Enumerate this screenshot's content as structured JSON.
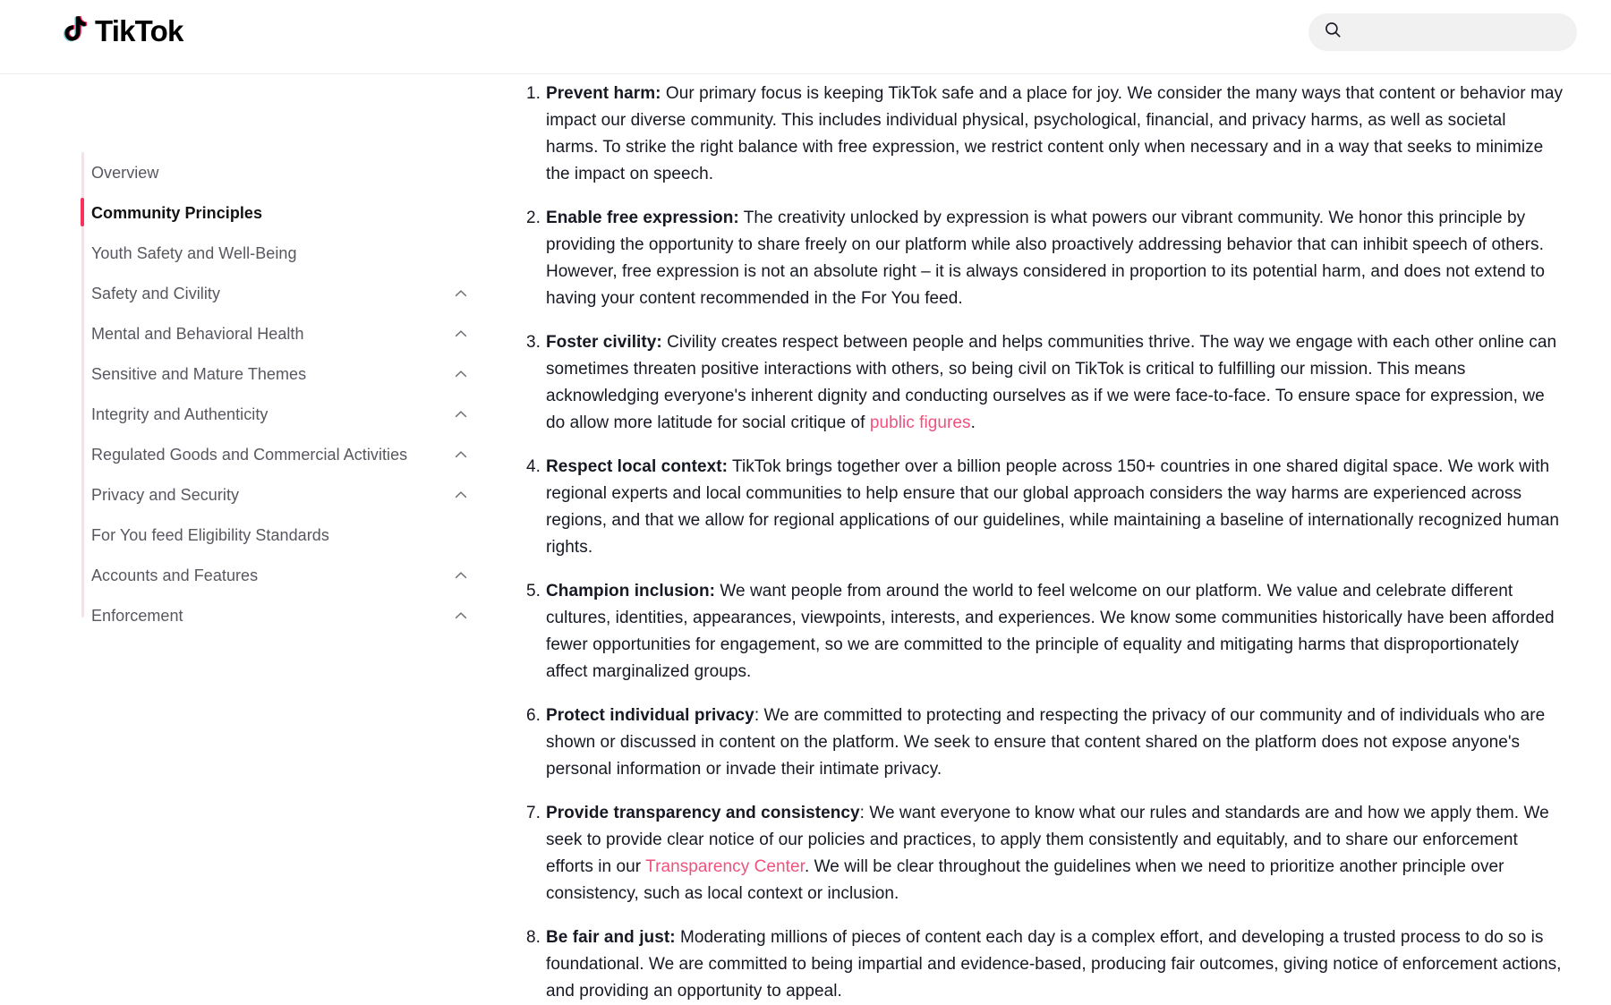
{
  "header": {
    "logo_word": "TikTok",
    "logo_icon": "tiktok-note-icon",
    "search": {
      "icon": "search-icon",
      "value": "",
      "placeholder": ""
    }
  },
  "sidebar": {
    "items": [
      {
        "label": "Overview",
        "active": false,
        "expandable": false,
        "chevron": ""
      },
      {
        "label": "Community Principles",
        "active": true,
        "expandable": false,
        "chevron": ""
      },
      {
        "label": "Youth Safety and Well-Being",
        "active": false,
        "expandable": false,
        "chevron": ""
      },
      {
        "label": "Safety and Civility",
        "active": false,
        "expandable": true,
        "chevron": "chevron-up-icon"
      },
      {
        "label": "Mental and Behavioral Health",
        "active": false,
        "expandable": true,
        "chevron": "chevron-up-icon"
      },
      {
        "label": "Sensitive and Mature Themes",
        "active": false,
        "expandable": true,
        "chevron": "chevron-up-icon"
      },
      {
        "label": "Integrity and Authenticity",
        "active": false,
        "expandable": true,
        "chevron": "chevron-up-icon"
      },
      {
        "label": "Regulated Goods and Commercial Activities",
        "active": false,
        "expandable": true,
        "chevron": "chevron-up-icon"
      },
      {
        "label": "Privacy and Security",
        "active": false,
        "expandable": true,
        "chevron": "chevron-up-icon"
      },
      {
        "label": "For You feed Eligibility Standards",
        "active": false,
        "expandable": false,
        "chevron": ""
      },
      {
        "label": "Accounts and Features",
        "active": false,
        "expandable": true,
        "chevron": "chevron-up-icon"
      },
      {
        "label": "Enforcement",
        "active": false,
        "expandable": true,
        "chevron": "chevron-up-icon"
      }
    ]
  },
  "main": {
    "principles": [
      {
        "number": "1.",
        "lead": "Prevent harm:",
        "body_before": " Our primary focus is keeping TikTok safe and a place for joy. We consider the many ways that content or behavior may impact our diverse community. This includes individual physical, psychological, financial, and privacy harms, as well as societal harms. To strike the right balance with free expression, we restrict content only when necessary and in a way that seeks to minimize the impact on speech.",
        "link": "",
        "body_after": ""
      },
      {
        "number": "2.",
        "lead": "Enable free expression:",
        "body_before": " The creativity unlocked by expression is what powers our vibrant community. We honor this principle by providing the opportunity to share freely on our platform while also proactively addressing behavior that can inhibit speech of others. However, free expression is not an absolute right – it is always considered in proportion to its potential harm, and does not extend to having your content recommended in the For You feed.",
        "link": "",
        "body_after": ""
      },
      {
        "number": "3.",
        "lead": "Foster civility:",
        "body_before": " Civility creates respect between people and helps communities thrive. The way we engage with each other online can sometimes threaten positive interactions with others, so being civil on TikTok is critical to fulfilling our mission. This means acknowledging everyone's inherent dignity and conducting ourselves as if we were face-to-face. To ensure space for expression, we do allow more latitude for social critique of ",
        "link": "public figures",
        "body_after": "."
      },
      {
        "number": "4.",
        "lead": "Respect local context:",
        "body_before": " TikTok brings together over a billion people across 150+ countries in one shared digital space. We work with regional experts and local communities to help ensure that our global approach considers the way harms are experienced across regions, and that we allow for regional applications of our guidelines, while maintaining a baseline of internationally recognized human rights.",
        "link": "",
        "body_after": ""
      },
      {
        "number": "5.",
        "lead": "Champion inclusion:",
        "body_before": " We want people from around the world to feel welcome on our platform. We value and celebrate different cultures, identities, appearances, viewpoints, interests, and experiences. We know some communities historically have been afforded fewer opportunities for engagement, so we are committed to the principle of equality and mitigating harms that disproportionately affect marginalized groups.",
        "link": "",
        "body_after": ""
      },
      {
        "number": "6.",
        "lead": "Protect individual privacy",
        "body_before": ": We are committed to protecting and respecting the privacy of our community and of individuals who are shown or discussed in content on the platform. We seek to ensure that content shared on the platform does not expose anyone's personal information or invade their intimate privacy.",
        "link": "",
        "body_after": ""
      },
      {
        "number": "7.",
        "lead": "Provide transparency and consistency",
        "body_before": ": We want everyone to know what our rules and standards are and how we apply them. We seek to provide clear notice of our policies and practices, to apply them consistently and equitably, and to share our enforcement efforts in our ",
        "link": "Transparency Center",
        "body_after": ". We will be clear throughout the guidelines when we need to prioritize another principle over consistency, such as local context or inclusion."
      },
      {
        "number": "8.",
        "lead": "Be fair and just:",
        "body_before": " Moderating millions of pieces of content each day is a complex effort, and developing a trusted process to do so is foundational. We are committed to being impartial and evidence-based, producing fair outcomes, giving notice of enforcement actions, and providing an opportunity to appeal.",
        "link": "",
        "body_after": ""
      }
    ]
  },
  "colors": {
    "brand_red": "#ee1d52",
    "brand_cyan": "#69c9d0",
    "link_pink": "#f0527e",
    "active_marker": "#f5335b",
    "rail": "#fbdfe6",
    "text": "#161823",
    "muted_text": "#57575f",
    "search_bg": "#f1f1f2",
    "header_border": "#ededf0"
  }
}
